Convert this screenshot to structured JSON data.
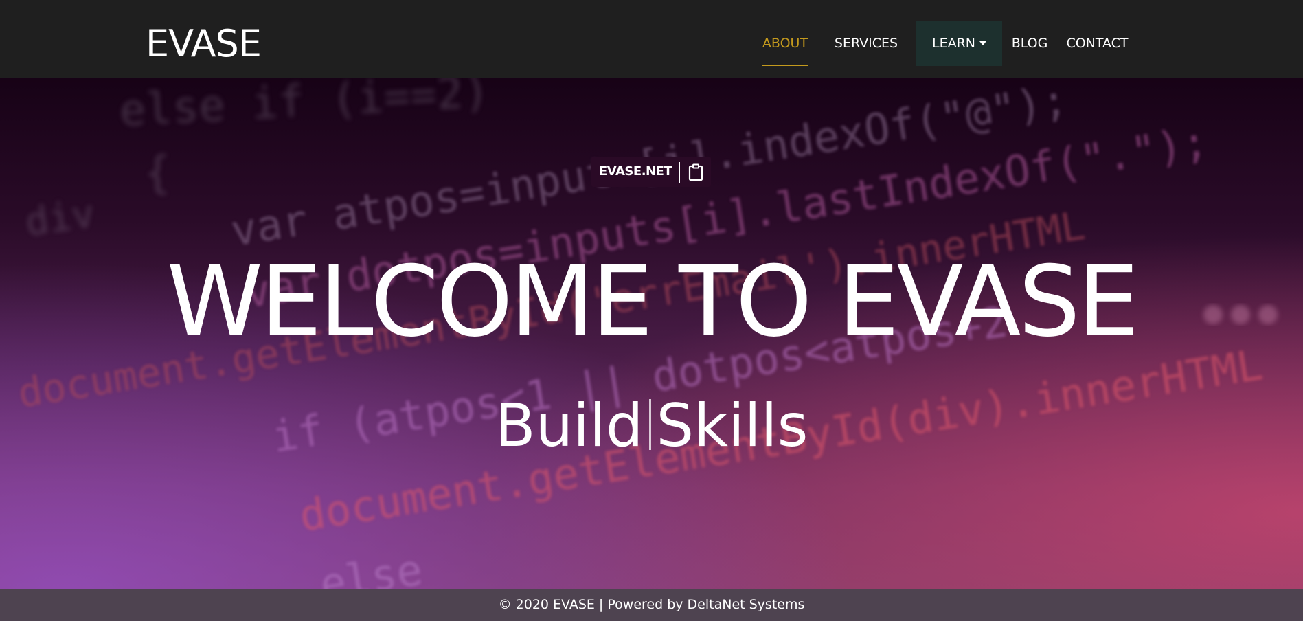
{
  "navbar": {
    "brand": "EVASE",
    "items": [
      {
        "label": "ABOUT",
        "active": true
      },
      {
        "label": "SERVICES"
      },
      {
        "label": "LEARN",
        "dropdown": true
      },
      {
        "label": "BLOG"
      },
      {
        "label": "CONTACT"
      }
    ],
    "active_color": "#c49a1d"
  },
  "domain_badge": {
    "text": "EVASE.NET",
    "icon": "clipboard-icon"
  },
  "hero": {
    "title": "WELCOME TO EVASE",
    "subtitle_left": "Build",
    "subtitle_right": "Skills"
  },
  "footer": {
    "text": "© 2020 EVASE | Powered by DeltaNet Systems"
  }
}
